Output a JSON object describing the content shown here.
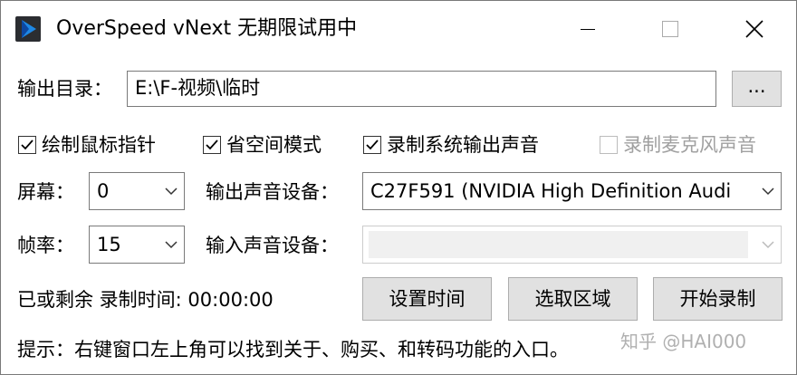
{
  "window": {
    "title": "OverSpeed vNext 无期限试用中",
    "icons": {
      "app": "play-logo-icon",
      "minimize": "minimize-icon",
      "maximize": "maximize-icon",
      "close": "close-icon"
    }
  },
  "output_dir": {
    "label": "输出目录：",
    "value": "E:\\F-视频\\临时",
    "browse_label": "..."
  },
  "options": {
    "draw_cursor": {
      "label": "绘制鼠标指针",
      "checked": true
    },
    "save_space": {
      "label": "省空间模式",
      "checked": true
    },
    "record_system_audio": {
      "label": "录制系统输出声音",
      "checked": true
    },
    "record_mic": {
      "label": "录制麦克风声音",
      "checked": false,
      "disabled": true
    }
  },
  "screen": {
    "label": "屏幕：",
    "value": "0"
  },
  "output_device": {
    "label": "输出声音设备：",
    "value": "C27F591 (NVIDIA High Definition Audi"
  },
  "framerate": {
    "label": "帧率：",
    "value": "15"
  },
  "input_device": {
    "label": "输入声音设备：",
    "value": ""
  },
  "timer": {
    "label": "已或剩余 录制时间: 00:00:00"
  },
  "buttons": {
    "set_time": "设置时间",
    "select_area": "选取区域",
    "start_record": "开始录制"
  },
  "hint": "提示：右键窗口左上角可以找到关于、购买、和转码功能的入口。",
  "watermark": "知乎 @HAI000",
  "colors": {
    "logo_dark": "#2b2d31",
    "logo_accent": "#1e88e5",
    "disabled_text": "#a0a0a0"
  }
}
